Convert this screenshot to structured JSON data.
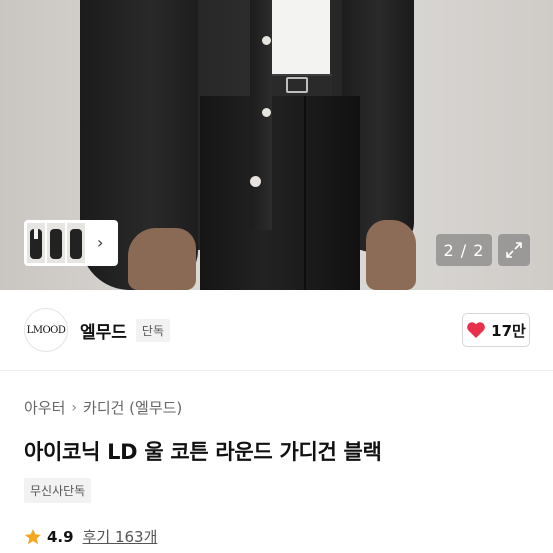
{
  "gallery": {
    "counter": "2 / 2",
    "thumbnail_arrow": "›",
    "expand_icon": "expand-icon"
  },
  "brand": {
    "logo_text": "LMOOD",
    "name": "엘무드",
    "badge": "단독"
  },
  "like": {
    "count": "17만",
    "icon": "heart-icon",
    "color": "#e8304a"
  },
  "breadcrumb": {
    "items": [
      "아우터",
      "카디건 (엘무드)"
    ],
    "separator": "›"
  },
  "product": {
    "title": "아이코닉 LD 울 코튼 라운드 가디건 블랙",
    "tag": "무신사단독"
  },
  "rating": {
    "score": "4.9",
    "reviews": "후기 163개",
    "star_color": "#f5a623"
  }
}
